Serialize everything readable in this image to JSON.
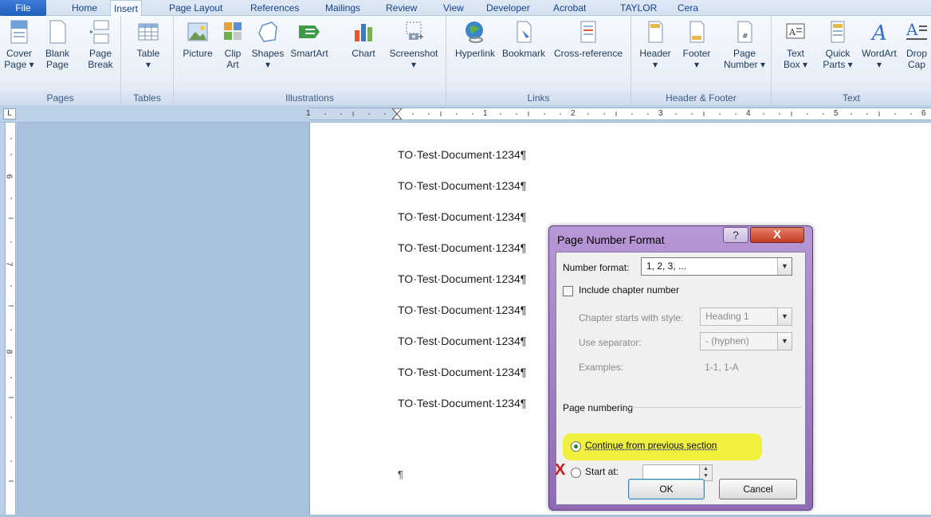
{
  "tabs": [
    "File",
    "Home",
    "Insert",
    "Page Layout",
    "References",
    "Mailings",
    "Review",
    "View",
    "Developer",
    "Acrobat",
    "TAYLOR",
    "Cera"
  ],
  "ribbon": {
    "groups": {
      "pages": "Pages",
      "tables": "Tables",
      "illustrations": "Illustrations",
      "links": "Links",
      "header_footer": "Header & Footer",
      "text": "Text"
    },
    "buttons": {
      "cover_page": [
        "Cover",
        "Page ▾"
      ],
      "blank_page": [
        "Blank",
        "Page"
      ],
      "page_break": [
        "Page",
        "Break"
      ],
      "table": [
        "Table",
        "▾"
      ],
      "picture": "Picture",
      "clip_art": [
        "Clip",
        "Art"
      ],
      "shapes": [
        "Shapes",
        "▾"
      ],
      "smartart": "SmartArt",
      "chart": "Chart",
      "screenshot": [
        "Screenshot",
        "▾"
      ],
      "hyperlink": "Hyperlink",
      "bookmark": "Bookmark",
      "cross_reference": "Cross-reference",
      "header": [
        "Header",
        "▾"
      ],
      "footer": [
        "Footer",
        "▾"
      ],
      "page_number": [
        "Page",
        "Number ▾"
      ],
      "text_box": [
        "Text",
        "Box ▾"
      ],
      "quick_parts": [
        "Quick",
        "Parts ▾"
      ],
      "wordart": [
        "WordArt",
        "▾"
      ],
      "drop_cap": [
        "Drop",
        "Cap"
      ]
    }
  },
  "rulers": {
    "corner": "L",
    "h_numbers": [
      "1",
      "1",
      "2",
      "3",
      "4",
      "5",
      "6"
    ],
    "v_numbers": [
      "6",
      "7",
      "8"
    ]
  },
  "document": {
    "lines": [
      "TO·Test·Document·1234¶",
      "TO·Test·Document·1234¶",
      "TO·Test·Document·1234¶",
      "TO·Test·Document·1234¶",
      "TO·Test·Document·1234¶",
      "TO·Test·Document·1234¶",
      "TO·Test·Document·1234¶",
      "TO·Test·Document·1234¶",
      "TO·Test·Document·1234¶"
    ],
    "end_mark": "¶"
  },
  "dialog": {
    "title": "Page Number Format",
    "help": "?",
    "close": "X",
    "number_format_label": "Number format:",
    "number_format_value": "1, 2, 3, ...",
    "include_chapter_label": "Include chapter number",
    "chapter_style_label": "Chapter starts with style:",
    "chapter_style_value": "Heading 1",
    "separator_label": "Use separator:",
    "separator_value": "-   (hyphen)",
    "examples_label": "Examples:",
    "examples_value": "1-1, 1-A",
    "page_numbering_label": "Page numbering",
    "continue_label": "Continue from previous section",
    "start_at_label": "Start at:",
    "start_at_value": "",
    "ok": "OK",
    "cancel": "Cancel",
    "annotation_mark": "X"
  },
  "colors": {
    "highlight": "#f0f02a",
    "annotation": "#d01818",
    "dialog_frame": "#9f7cc4"
  }
}
